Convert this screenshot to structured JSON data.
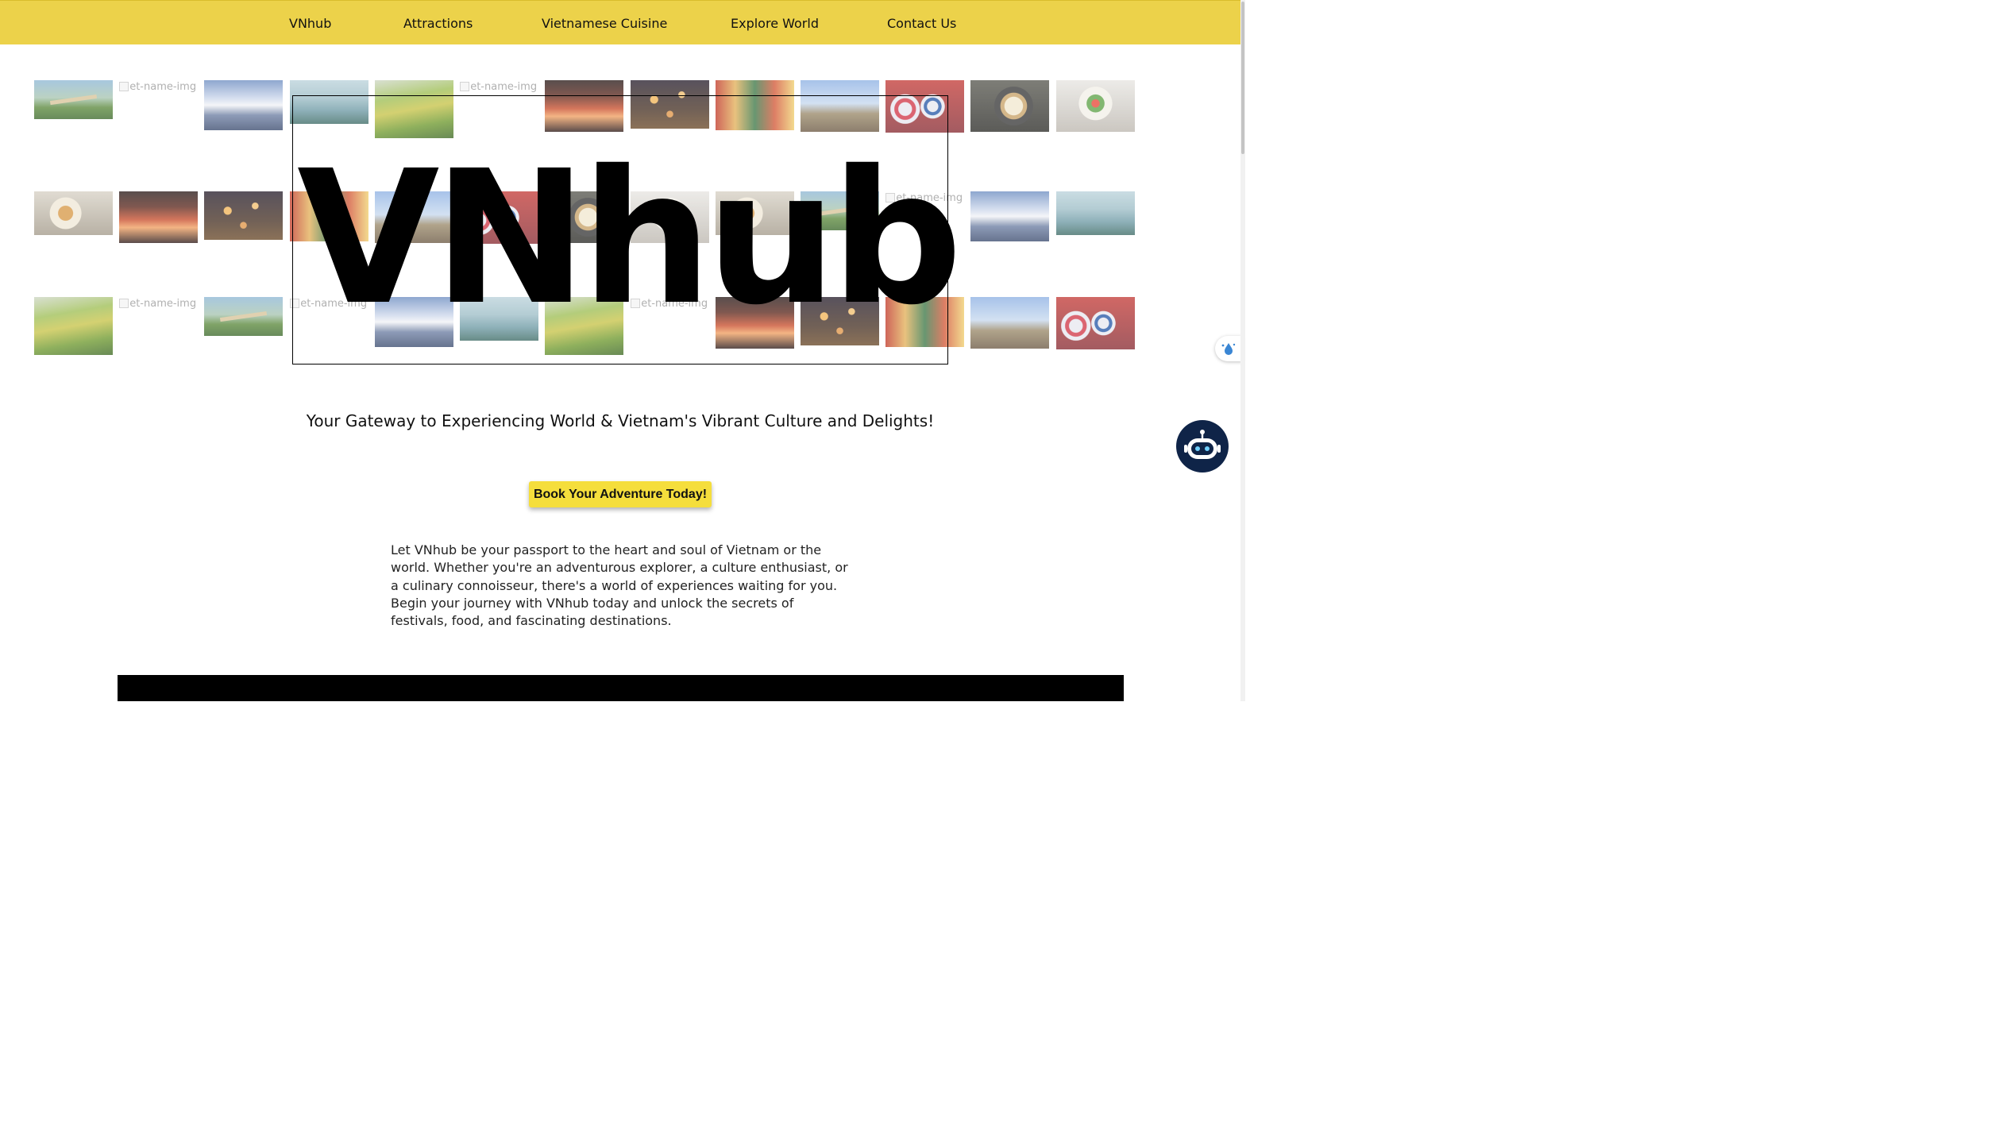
{
  "nav": {
    "items": [
      {
        "label": "VNhub"
      },
      {
        "label": "Attractions"
      },
      {
        "label": "Vietnamese Cuisine"
      },
      {
        "label": "Explore World"
      },
      {
        "label": "Contact Us"
      }
    ]
  },
  "gallery": {
    "broken_alt": "viet-name-img"
  },
  "hero": {
    "title": "VNhub"
  },
  "tagline": "Your Gateway to Experiencing World & Vietnam's Vibrant Culture and Delights!",
  "cta_label": "Book Your Adventure Today!",
  "intro": "Let VNhub be your passport to the heart and soul of Vietnam or the world. Whether you're an adventurous explorer, a culture enthusiast, or a culinary connoisseur, there's a world of experiences waiting for you. Begin your journey with VNhub today and unlock the secrets of festivals, food, and fascinating destinations.",
  "colors": {
    "nav_background": "#ecd24a",
    "cta_background": "#f5de3c",
    "chatbot_background": "#0f2448"
  },
  "icons": {
    "chatbot": "robot-chat-icon",
    "side_widget": "droplet-icon"
  }
}
